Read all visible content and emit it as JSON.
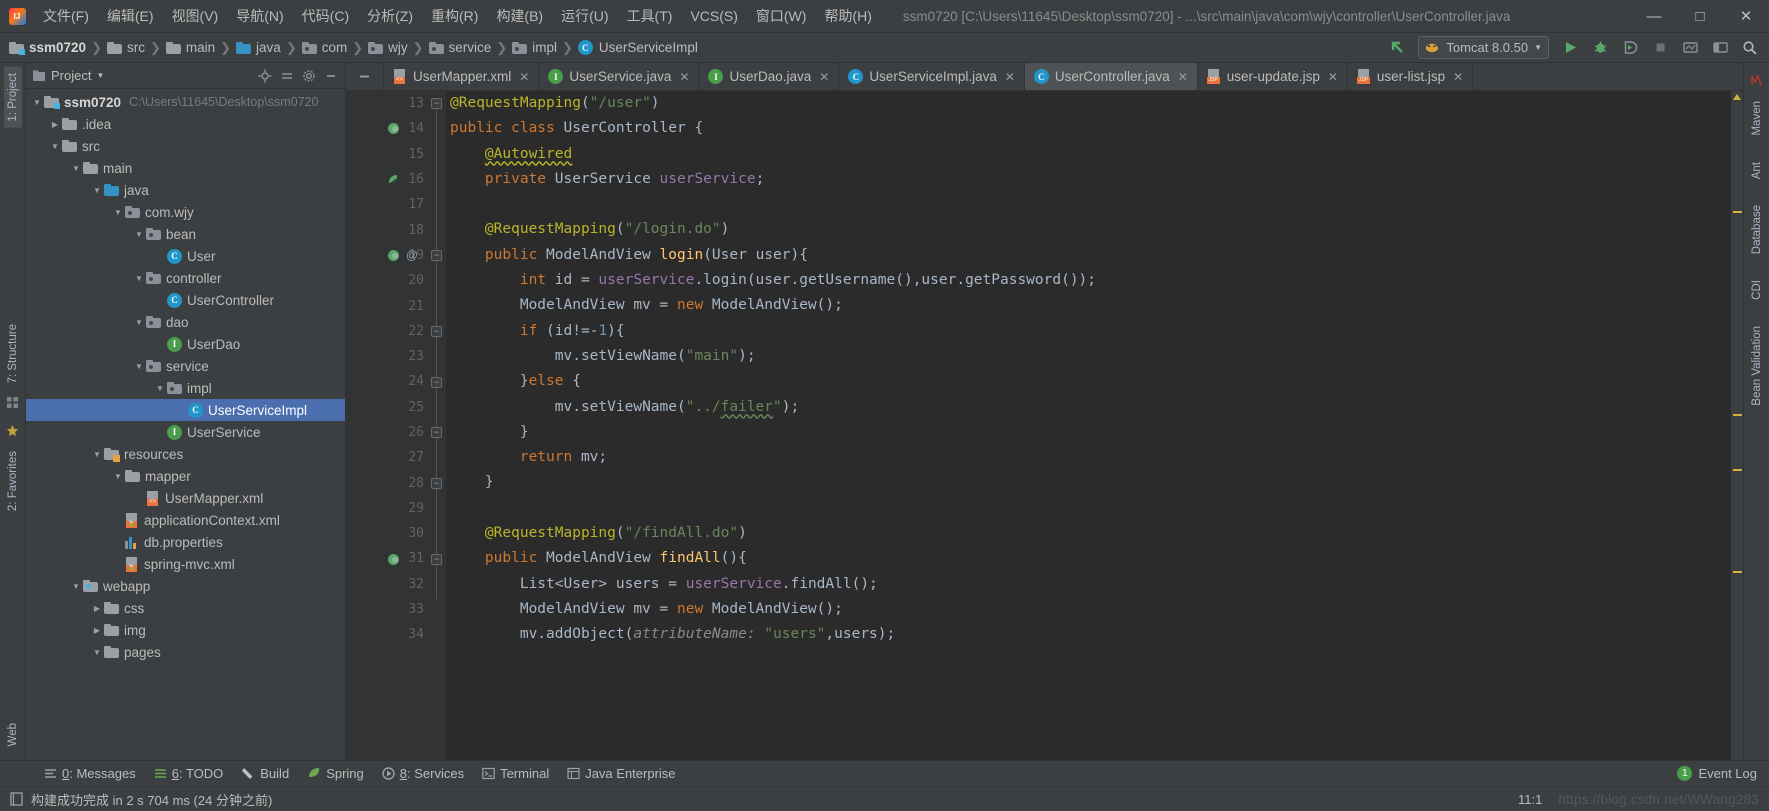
{
  "window": {
    "title": "ssm0720 [C:\\Users\\11645\\Desktop\\ssm0720] - ...\\src\\main\\java\\com\\wjy\\controller\\UserController.java",
    "minimize": "—",
    "maximize": "□",
    "close": "✕"
  },
  "menu": [
    {
      "label": "文件(F)"
    },
    {
      "label": "编辑(E)"
    },
    {
      "label": "视图(V)"
    },
    {
      "label": "导航(N)"
    },
    {
      "label": "代码(C)"
    },
    {
      "label": "分析(Z)"
    },
    {
      "label": "重构(R)"
    },
    {
      "label": "构建(B)"
    },
    {
      "label": "运行(U)"
    },
    {
      "label": "工具(T)"
    },
    {
      "label": "VCS(S)"
    },
    {
      "label": "窗口(W)"
    },
    {
      "label": "帮助(H)"
    }
  ],
  "breadcrumb": [
    {
      "label": "ssm0720",
      "icon": "module-folder-icon"
    },
    {
      "label": "src",
      "icon": "source-folder-icon"
    },
    {
      "label": "main",
      "icon": "folder-icon"
    },
    {
      "label": "java",
      "icon": "source-root-icon"
    },
    {
      "label": "com",
      "icon": "package-icon"
    },
    {
      "label": "wjy",
      "icon": "package-icon"
    },
    {
      "label": "service",
      "icon": "package-icon"
    },
    {
      "label": "impl",
      "icon": "package-icon"
    },
    {
      "label": "UserServiceImpl",
      "icon": "class-icon"
    }
  ],
  "toolbar": {
    "run_config": "Tomcat 8.0.50",
    "run_label": "Run",
    "debug_label": "Debug",
    "coverage_label": "Run with Coverage",
    "stop_label": "Stop",
    "search_label": "Search Everywhere",
    "updates_label": "Update Project"
  },
  "project_panel": {
    "title": "Project",
    "tree": [
      {
        "depth": 0,
        "label": "ssm0720",
        "path": "C:\\Users\\11645\\Desktop\\ssm0720",
        "icon": "module-folder-icon",
        "arrow": "▼",
        "bold": true
      },
      {
        "depth": 1,
        "label": ".idea",
        "icon": "folder-icon",
        "arrow": "▶"
      },
      {
        "depth": 1,
        "label": "src",
        "icon": "folder-icon",
        "arrow": "▼"
      },
      {
        "depth": 2,
        "label": "main",
        "icon": "folder-icon",
        "arrow": "▼"
      },
      {
        "depth": 3,
        "label": "java",
        "icon": "source-root-icon",
        "arrow": "▼"
      },
      {
        "depth": 4,
        "label": "com.wjy",
        "icon": "package-icon",
        "arrow": "▼"
      },
      {
        "depth": 5,
        "label": "bean",
        "icon": "package-icon",
        "arrow": "▼"
      },
      {
        "depth": 6,
        "label": "User",
        "icon": "class-icon",
        "arrow": ""
      },
      {
        "depth": 5,
        "label": "controller",
        "icon": "package-icon",
        "arrow": "▼"
      },
      {
        "depth": 6,
        "label": "UserController",
        "icon": "class-icon",
        "arrow": ""
      },
      {
        "depth": 5,
        "label": "dao",
        "icon": "package-icon",
        "arrow": "▼"
      },
      {
        "depth": 6,
        "label": "UserDao",
        "icon": "interface-icon",
        "arrow": ""
      },
      {
        "depth": 5,
        "label": "service",
        "icon": "package-icon",
        "arrow": "▼"
      },
      {
        "depth": 6,
        "label": "impl",
        "icon": "package-icon",
        "arrow": "▼"
      },
      {
        "depth": 7,
        "label": "UserServiceImpl",
        "icon": "class-icon",
        "arrow": "",
        "selected": true
      },
      {
        "depth": 6,
        "label": "UserService",
        "icon": "interface-icon",
        "arrow": ""
      },
      {
        "depth": 3,
        "label": "resources",
        "icon": "resource-folder-icon",
        "arrow": "▼"
      },
      {
        "depth": 4,
        "label": "mapper",
        "icon": "folder-icon",
        "arrow": "▼"
      },
      {
        "depth": 5,
        "label": "UserMapper.xml",
        "icon": "xml-file-icon",
        "arrow": ""
      },
      {
        "depth": 4,
        "label": "applicationContext.xml",
        "icon": "spring-xml-icon",
        "arrow": ""
      },
      {
        "depth": 4,
        "label": "db.properties",
        "icon": "properties-file-icon",
        "arrow": ""
      },
      {
        "depth": 4,
        "label": "spring-mvc.xml",
        "icon": "spring-xml-icon",
        "arrow": ""
      },
      {
        "depth": 2,
        "label": "webapp",
        "icon": "web-folder-icon",
        "arrow": "▼"
      },
      {
        "depth": 3,
        "label": "css",
        "icon": "folder-icon",
        "arrow": "▶"
      },
      {
        "depth": 3,
        "label": "img",
        "icon": "folder-icon",
        "arrow": "▶"
      },
      {
        "depth": 3,
        "label": "pages",
        "icon": "folder-icon",
        "arrow": "▼"
      }
    ]
  },
  "editor_tabs": [
    {
      "label": "UserMapper.xml",
      "icon": "xml-file-icon",
      "active": false,
      "close": "✕"
    },
    {
      "label": "UserService.java",
      "icon": "interface-icon",
      "active": false,
      "close": "✕"
    },
    {
      "label": "UserDao.java",
      "icon": "interface-icon",
      "active": false,
      "close": "✕"
    },
    {
      "label": "UserServiceImpl.java",
      "icon": "class-icon",
      "active": false,
      "close": "✕"
    },
    {
      "label": "UserController.java",
      "icon": "class-icon",
      "active": true,
      "close": "✕"
    },
    {
      "label": "user-update.jsp",
      "icon": "jsp-file-icon",
      "active": false,
      "close": "✕"
    },
    {
      "label": "user-list.jsp",
      "icon": "jsp-file-icon",
      "active": false,
      "close": "✕"
    }
  ],
  "code": {
    "first_line": 13,
    "lines": [
      {
        "n": 13,
        "html": "<span class=\"ann\">@RequestMapping</span><span class=\"txt\">(</span><span class=\"str\">\"/user\"</span><span class=\"txt\">)</span>",
        "indent": 0
      },
      {
        "n": 14,
        "html": "<span class=\"kw\">public class </span><span class=\"txt\">UserController {</span>",
        "indent": 0
      },
      {
        "n": 15,
        "html": "    <span class=\"ann wavy\">@Autowired</span>",
        "indent": 0
      },
      {
        "n": 16,
        "html": "    <span class=\"kw\">private </span><span class=\"txt\">UserService </span><span class=\"fld\">userService</span><span class=\"txt\">;</span>",
        "indent": 0
      },
      {
        "n": 17,
        "html": "",
        "indent": 0
      },
      {
        "n": 18,
        "html": "    <span class=\"ann\">@RequestMapping</span><span class=\"txt\">(</span><span class=\"str\">\"/login.do\"</span><span class=\"txt\">)</span>",
        "indent": 0
      },
      {
        "n": 19,
        "html": "    <span class=\"kw\">public </span><span class=\"txt\">ModelAndView </span><span class=\"mth\">login</span><span class=\"txt\">(User user){</span>",
        "indent": 0
      },
      {
        "n": 20,
        "html": "        <span class=\"kw\">int </span><span class=\"txt\">id = </span><span class=\"fld\">userService</span><span class=\"txt\">.login(user.getUsername(),user.getPassword());</span>",
        "indent": 0
      },
      {
        "n": 21,
        "html": "        <span class=\"txt\">ModelAndView mv = </span><span class=\"kw\">new </span><span class=\"txt\">ModelAndView();</span>",
        "indent": 0
      },
      {
        "n": 22,
        "html": "        <span class=\"kw\">if </span><span class=\"txt\">(id!=-</span><span class=\"num\">1</span><span class=\"txt\">){</span>",
        "indent": 0
      },
      {
        "n": 23,
        "html": "            <span class=\"txt\">mv.setViewName(</span><span class=\"str\">\"main\"</span><span class=\"txt\">);</span>",
        "indent": 0
      },
      {
        "n": 24,
        "html": "        <span class=\"txt\">}</span><span class=\"kw\">else </span><span class=\"txt\">{</span>",
        "indent": 0
      },
      {
        "n": 25,
        "html": "            <span class=\"txt\">mv.setViewName(</span><span class=\"str\">\"../</span><span class=\"str wavy-g\">failer</span><span class=\"str\">\"</span><span class=\"txt\">);</span>",
        "indent": 0
      },
      {
        "n": 26,
        "html": "        <span class=\"txt\">}</span>",
        "indent": 0
      },
      {
        "n": 27,
        "html": "        <span class=\"kw\">return </span><span class=\"txt\">mv;</span>",
        "indent": 0
      },
      {
        "n": 28,
        "html": "    <span class=\"txt\">}</span>",
        "indent": 0
      },
      {
        "n": 29,
        "html": "",
        "indent": 0
      },
      {
        "n": 30,
        "html": "    <span class=\"ann\">@RequestMapping</span><span class=\"txt\">(</span><span class=\"str\">\"/findAll.do\"</span><span class=\"txt\">)</span>",
        "indent": 0
      },
      {
        "n": 31,
        "html": "    <span class=\"kw\">public </span><span class=\"txt\">ModelAndView </span><span class=\"mth\">findAll</span><span class=\"txt\">(){</span>",
        "indent": 0
      },
      {
        "n": 32,
        "html": "        <span class=\"txt\">List&lt;User&gt; users = </span><span class=\"fld\">userService</span><span class=\"txt\">.findAll();</span>",
        "indent": 0
      },
      {
        "n": 33,
        "html": "        <span class=\"txt\">ModelAndView mv = </span><span class=\"kw\">new </span><span class=\"txt\">ModelAndView();</span>",
        "indent": 0
      },
      {
        "n": 34,
        "html": "        <span class=\"txt\">mv.addObject(</span><span class=\"hintp\">attributeName:</span><span class=\"txt\"> </span><span class=\"str\">\"users\"</span><span class=\"txt\">,users);</span>",
        "indent": 0
      }
    ]
  },
  "tool_windows": [
    {
      "num": "0",
      "label": ": Messages",
      "icon": "messages-icon"
    },
    {
      "num": "6",
      "label": ": TODO",
      "icon": "todo-icon"
    },
    {
      "num": "",
      "label": "Build",
      "icon": "build-icon"
    },
    {
      "num": "",
      "label": "Spring",
      "icon": "spring-icon"
    },
    {
      "num": "8",
      "label": ": Services",
      "icon": "services-icon"
    },
    {
      "num": "",
      "label": "Terminal",
      "icon": "terminal-icon"
    },
    {
      "num": "",
      "label": "Java Enterprise",
      "icon": "java-enterprise-icon"
    }
  ],
  "event_log": {
    "count": "1",
    "label": "Event Log"
  },
  "status_bar": {
    "message": "构建成功完成 in 2 s 704 ms (24 分钟之前)",
    "caret": "11:1",
    "watermark": "https://blog.csdn.net/WWang283"
  },
  "left_rail": [
    {
      "label": "1: Project",
      "active": true
    },
    {
      "label": "7: Structure",
      "active": false
    },
    {
      "label": "2: Favorites",
      "active": false
    },
    {
      "label": "Web",
      "active": false
    }
  ],
  "right_rail": [
    {
      "label": "Maven"
    },
    {
      "label": "Ant"
    },
    {
      "label": "Database"
    },
    {
      "label": "CDI"
    },
    {
      "label": "Bean Validation"
    }
  ],
  "colors": {
    "bg_chrome": "#3c3f41",
    "bg_editor": "#2b2b2b",
    "gutter": "#313335",
    "selection": "#4b6eaf",
    "accent_green": "#499c54",
    "accent_blue": "#3592c4",
    "keyword": "#cc7832",
    "string": "#6a8759",
    "annotation": "#bbb529",
    "field": "#9876aa",
    "method": "#ffc66d",
    "number": "#6897bb",
    "text": "#a9b7c6"
  }
}
